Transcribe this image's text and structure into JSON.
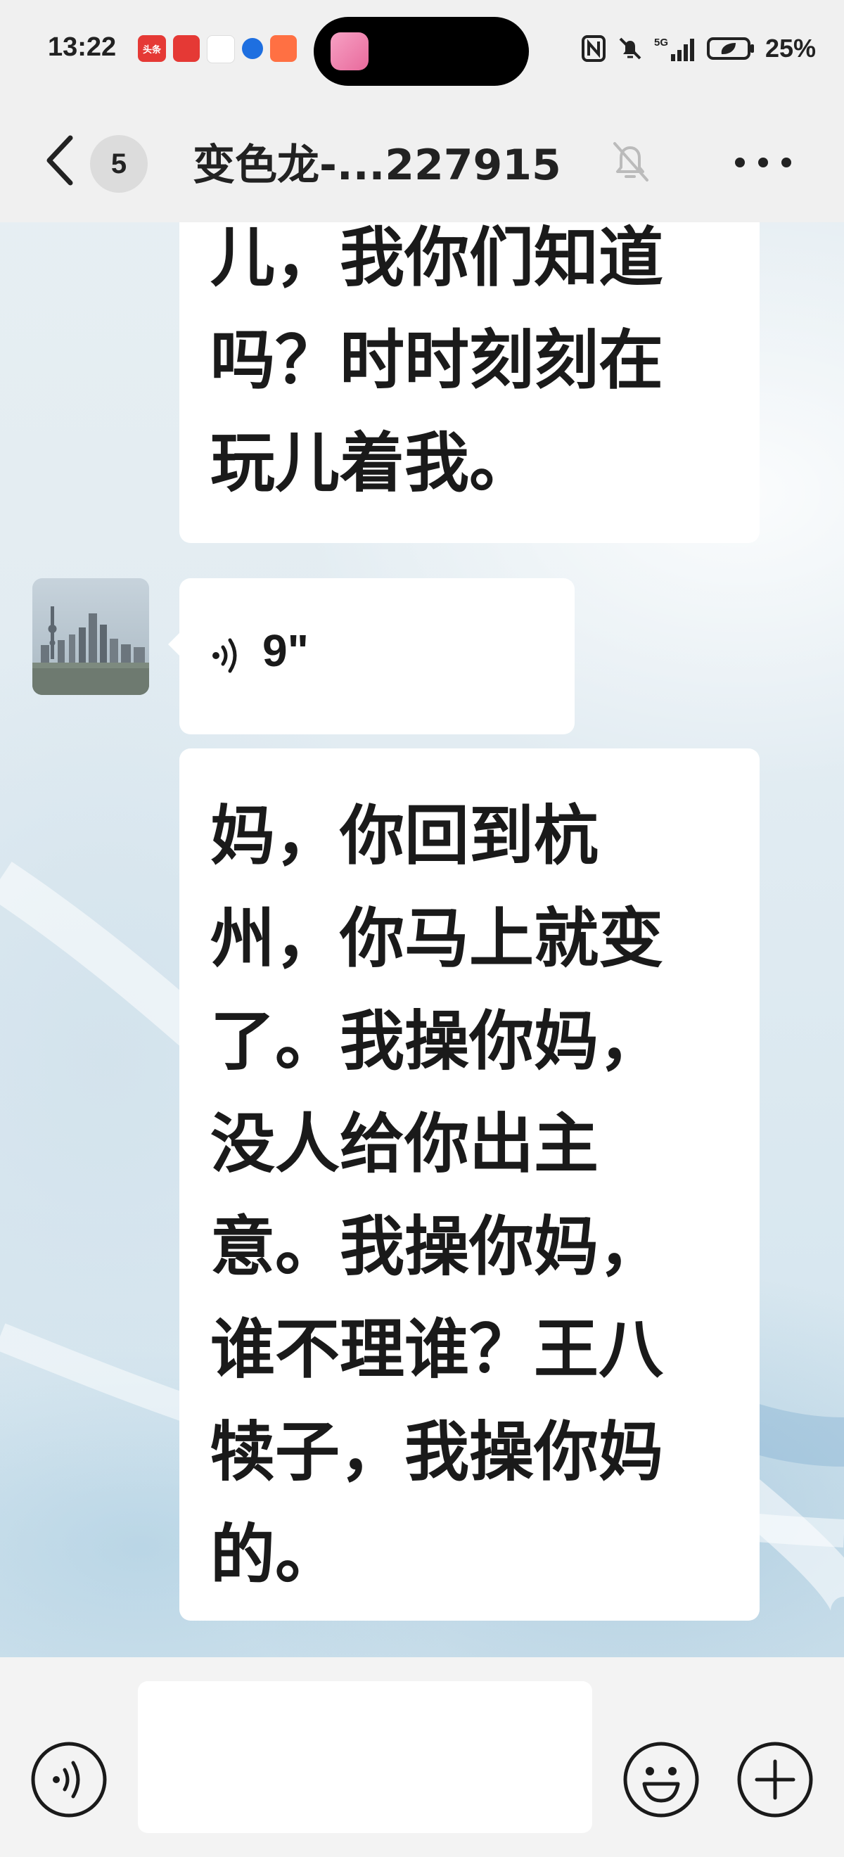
{
  "status_bar": {
    "time": "13:22",
    "notification_icons": [
      "头条",
      "小红书",
      "app-icon",
      "shield-icon",
      "app-icon"
    ],
    "network": "5G",
    "battery": "25%"
  },
  "header": {
    "unread_count": "5",
    "title": "变色龙-...227915"
  },
  "messages": [
    {
      "type": "text",
      "lines": [
        "儿，我你们知道",
        "吗？时时刻刻在",
        "玩儿着我。"
      ]
    },
    {
      "type": "voice",
      "duration": "9\""
    },
    {
      "type": "text",
      "lines": [
        "妈，你回到杭",
        "州，你马上就变",
        "了。我操你妈，",
        "没人给你出主",
        "意。我操你妈，",
        "谁不理谁？王八",
        "犊子，我操你妈",
        "的。"
      ]
    }
  ],
  "input_bar": {
    "text": ""
  },
  "colors": {
    "bubble": "#ffffff",
    "bar": "#f0f0f0",
    "text": "#1a1a1a"
  }
}
